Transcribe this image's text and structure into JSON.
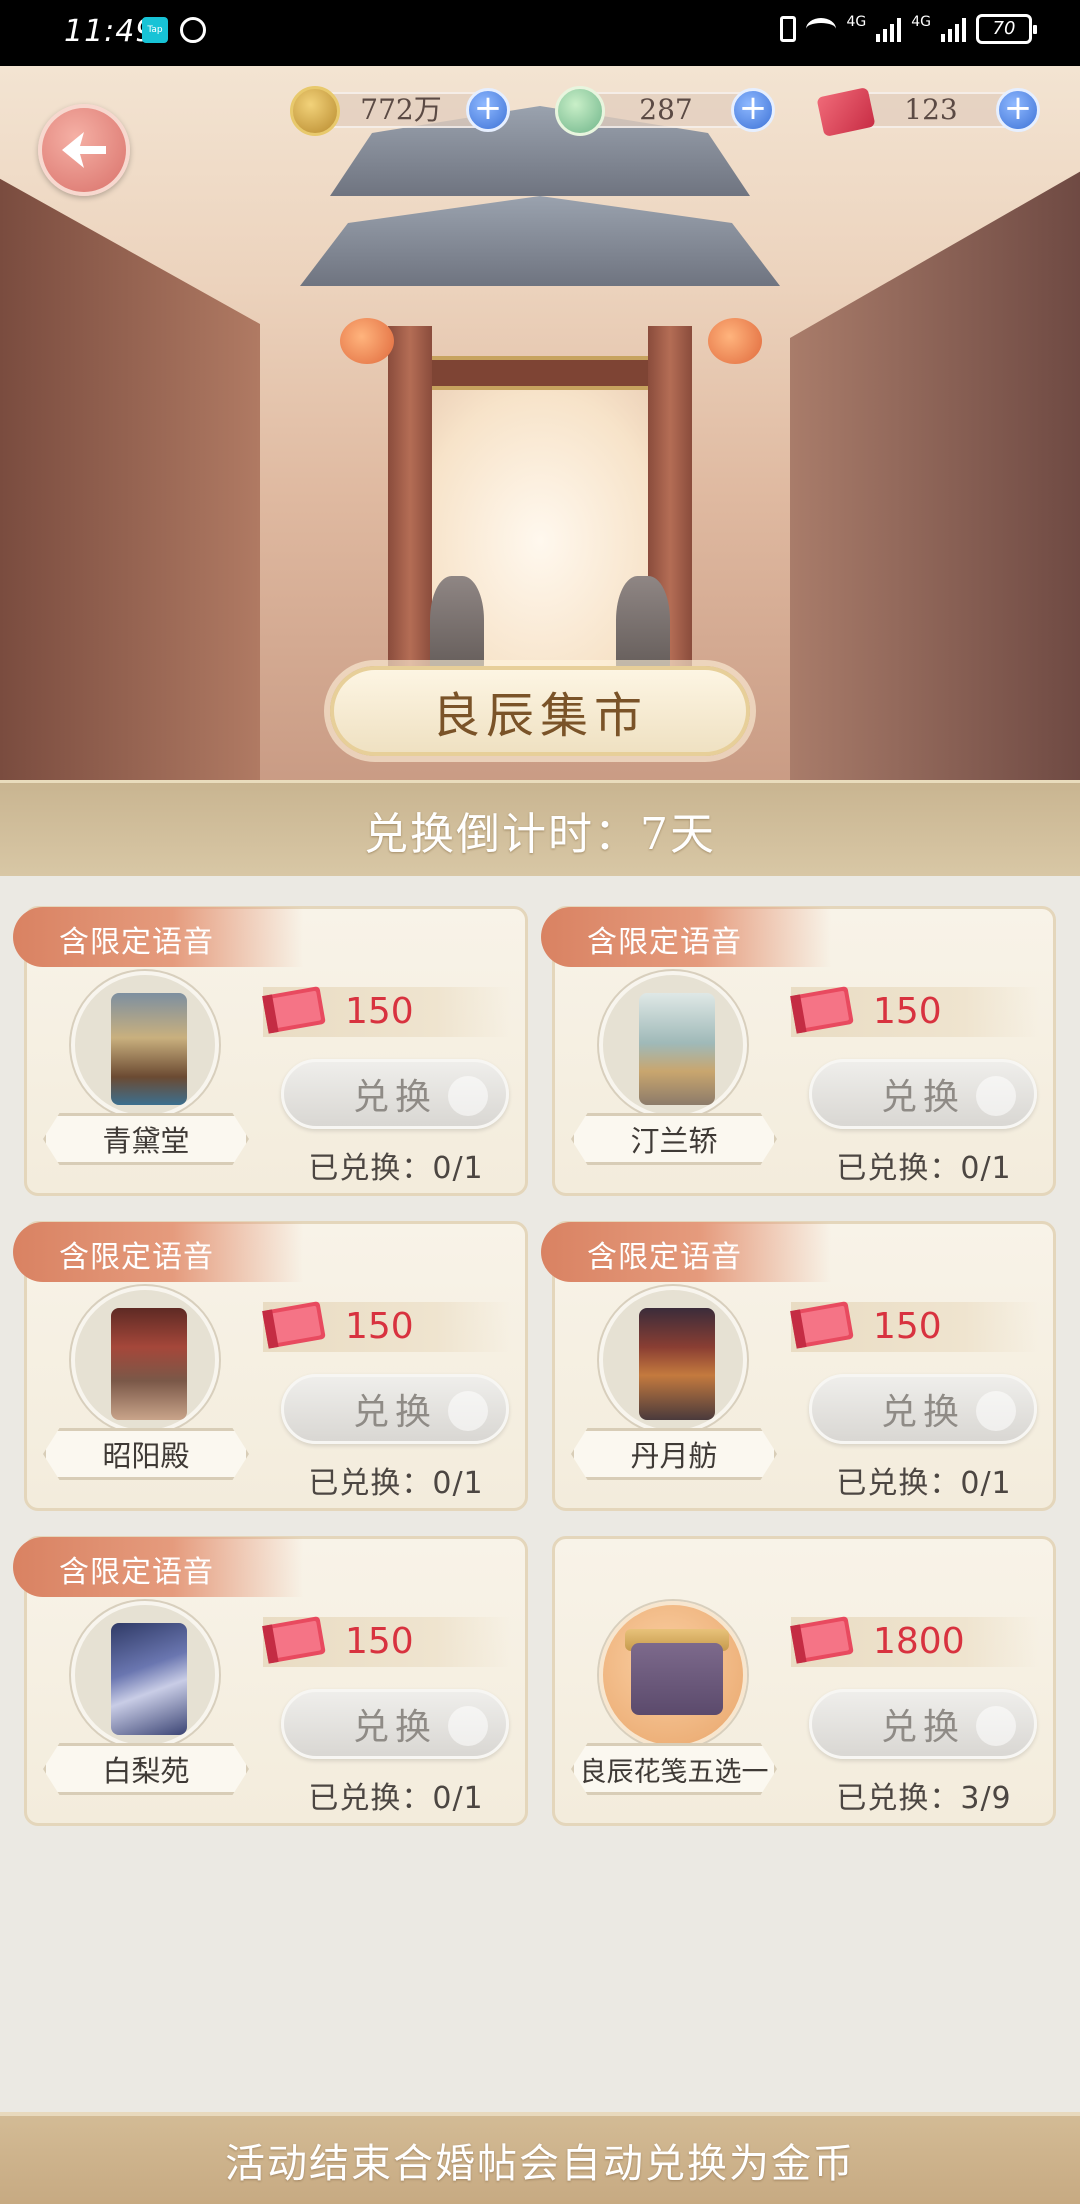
{
  "status_bar": {
    "time": "11:49",
    "tap_label": "Tap",
    "net_1": "4G",
    "net_2": "4G",
    "battery": "70"
  },
  "header": {
    "title": "良辰集市",
    "back_icon": "arrow-left-icon",
    "currencies": [
      {
        "icon": "paw-coin-icon",
        "value": "772万"
      },
      {
        "icon": "jade-charm-icon",
        "value": "287"
      },
      {
        "icon": "red-book-icon",
        "value": "123"
      }
    ]
  },
  "countdown": {
    "text": "兑换倒计时：7天"
  },
  "items": [
    {
      "tag": "含限定语音",
      "name": "青黛堂",
      "price": "150",
      "button": "兑换",
      "redeemed": "已兑换：0/1"
    },
    {
      "tag": "含限定语音",
      "name": "汀兰轿",
      "price": "150",
      "button": "兑换",
      "redeemed": "已兑换：0/1"
    },
    {
      "tag": "含限定语音",
      "name": "昭阳殿",
      "price": "150",
      "button": "兑换",
      "redeemed": "已兑换：0/1"
    },
    {
      "tag": "含限定语音",
      "name": "丹月舫",
      "price": "150",
      "button": "兑换",
      "redeemed": "已兑换：0/1"
    },
    {
      "tag": "含限定语音",
      "name": "白梨苑",
      "price": "150",
      "button": "兑换",
      "redeemed": "已兑换：0/1"
    },
    {
      "tag": "",
      "name": "良辰花笺五选一",
      "price": "1800",
      "button": "兑换",
      "redeemed": "已兑换：3/9"
    }
  ],
  "footer": {
    "notice": "活动结束合婚帖会自动兑换为金币"
  },
  "colors": {
    "price_red": "#d8323f",
    "tag_orange": "#d98262",
    "plus_blue": "#3d72d6"
  }
}
